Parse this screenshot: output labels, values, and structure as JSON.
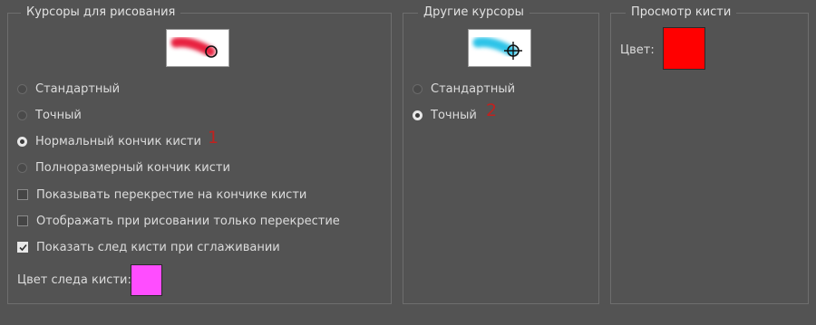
{
  "drawing_cursors": {
    "title": "Курсоры для рисования",
    "options": [
      {
        "label": "Стандартный",
        "checked": false
      },
      {
        "label": "Точный",
        "checked": false
      },
      {
        "label": "Нормальный кончик кисти",
        "checked": true
      },
      {
        "label": "Полноразмерный кончик кисти",
        "checked": false
      }
    ],
    "checkboxes": [
      {
        "label": "Показывать перекрестие на кончике кисти",
        "checked": false
      },
      {
        "label": "Отображать при рисовании только перекрестие",
        "checked": false
      },
      {
        "label": "Показать след кисти при сглаживании",
        "checked": true
      }
    ],
    "trail_color_label": "Цвет следа кисти:",
    "trail_color": "#ff4dff",
    "annotation": "1"
  },
  "other_cursors": {
    "title": "Другие курсоры",
    "options": [
      {
        "label": "Стандартный",
        "checked": false
      },
      {
        "label": "Точный",
        "checked": true
      }
    ],
    "annotation": "2"
  },
  "brush_preview": {
    "title": "Просмотр кисти",
    "color_label": "Цвет:",
    "color": "#ff0000"
  },
  "colors": {
    "annotation": "#c0221f",
    "stroke_red": "#e8213f",
    "stroke_cyan": "#2ec4e8"
  }
}
